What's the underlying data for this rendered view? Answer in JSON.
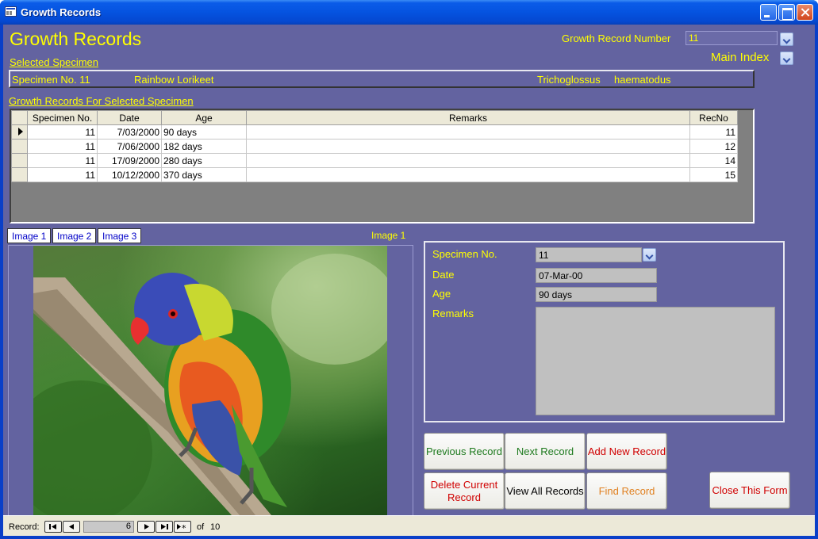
{
  "window": {
    "title": "Growth Records"
  },
  "header": {
    "form_title": "Growth Records",
    "record_number_label": "Growth Record Number",
    "record_number_value": "11",
    "main_index_label": "Main Index"
  },
  "selected_specimen": {
    "section_label": "Selected Specimen",
    "specimen_no": "Specimen No.  11",
    "common_name": "Rainbow Lorikeet",
    "genus": "Trichoglossus",
    "species": "haematodus"
  },
  "growth_grid": {
    "section_label": "Growth Records For Selected Specimen",
    "columns": [
      "Specimen No.",
      "Date",
      "Age",
      "Remarks",
      "RecNo"
    ],
    "rows": [
      {
        "specimen_no": "11",
        "date": "7/03/2000",
        "age": "90 days",
        "remarks": "",
        "recno": "11"
      },
      {
        "specimen_no": "11",
        "date": "7/06/2000",
        "age": "182 days",
        "remarks": "",
        "recno": "12"
      },
      {
        "specimen_no": "11",
        "date": "17/09/2000",
        "age": "280 days",
        "remarks": "",
        "recno": "14"
      },
      {
        "specimen_no": "11",
        "date": "10/12/2000",
        "age": "370 days",
        "remarks": "",
        "recno": "15"
      }
    ]
  },
  "images": {
    "tabs": [
      "Image 1",
      "Image 2",
      "Image 3"
    ],
    "current_label": "Image 1",
    "photo_description": "Rainbow lorikeet perched on a branch"
  },
  "detail": {
    "specimen_label": "Specimen No.",
    "specimen_value": "11",
    "date_label": "Date",
    "date_value": "07-Mar-00",
    "age_label": "Age",
    "age_value": "90 days",
    "remarks_label": "Remarks",
    "remarks_value": ""
  },
  "buttons": {
    "previous": "Previous Record",
    "next": "Next Record",
    "add_new": "Add New Record",
    "delete": "Delete Current Record",
    "view_all": "View All Records",
    "find": "Find Record",
    "close": "Close This Form"
  },
  "colors": {
    "label_yellow": "#ffff00",
    "form_bg": "#6363a0",
    "green": "#1e7a1e",
    "red": "#d00000",
    "orange": "#e08020"
  },
  "navigation": {
    "record_label": "Record:",
    "current": "6",
    "of_label": "of",
    "total": "10"
  }
}
